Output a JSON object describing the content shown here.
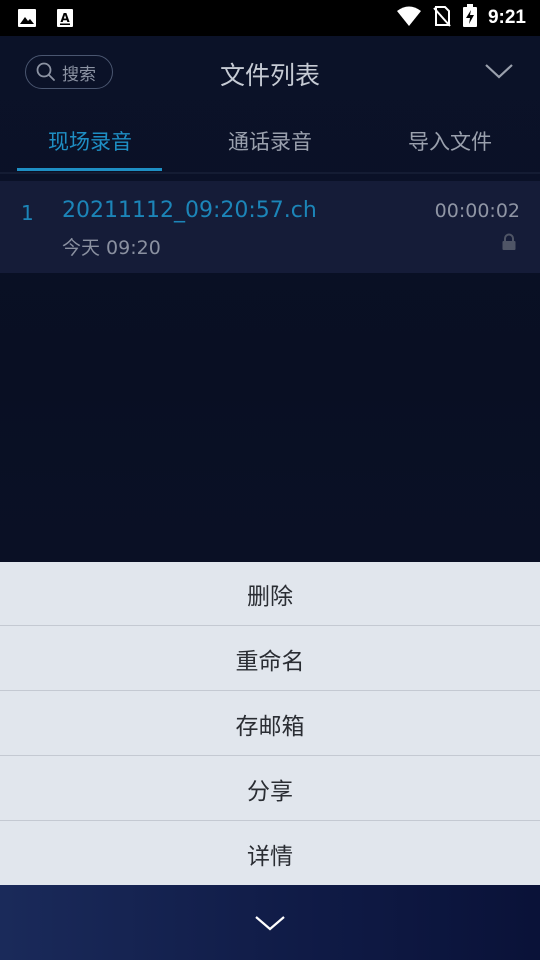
{
  "status_bar": {
    "time": "9:21",
    "icons": [
      "image-icon",
      "a-notification-icon",
      "wifi-icon",
      "no-sim-icon",
      "battery-charging-icon"
    ]
  },
  "header": {
    "search_label": "搜索",
    "title": "文件列表"
  },
  "tabs": [
    {
      "label": "现场录音",
      "active": true
    },
    {
      "label": "通话录音",
      "active": false
    },
    {
      "label": "导入文件",
      "active": false
    }
  ],
  "files": [
    {
      "index": "1",
      "name": "20211112_09:20:57.ch",
      "time": "今天 09:20",
      "duration": "00:00:02",
      "locked": true
    }
  ],
  "action_sheet": {
    "items": [
      {
        "label": "删除"
      },
      {
        "label": "重命名"
      },
      {
        "label": "存邮箱"
      },
      {
        "label": "分享"
      },
      {
        "label": "详情"
      }
    ]
  },
  "colors": {
    "accent": "#1e8fc4",
    "sheet_bg": "#e1e6ed",
    "app_bg": "#0b1228"
  }
}
